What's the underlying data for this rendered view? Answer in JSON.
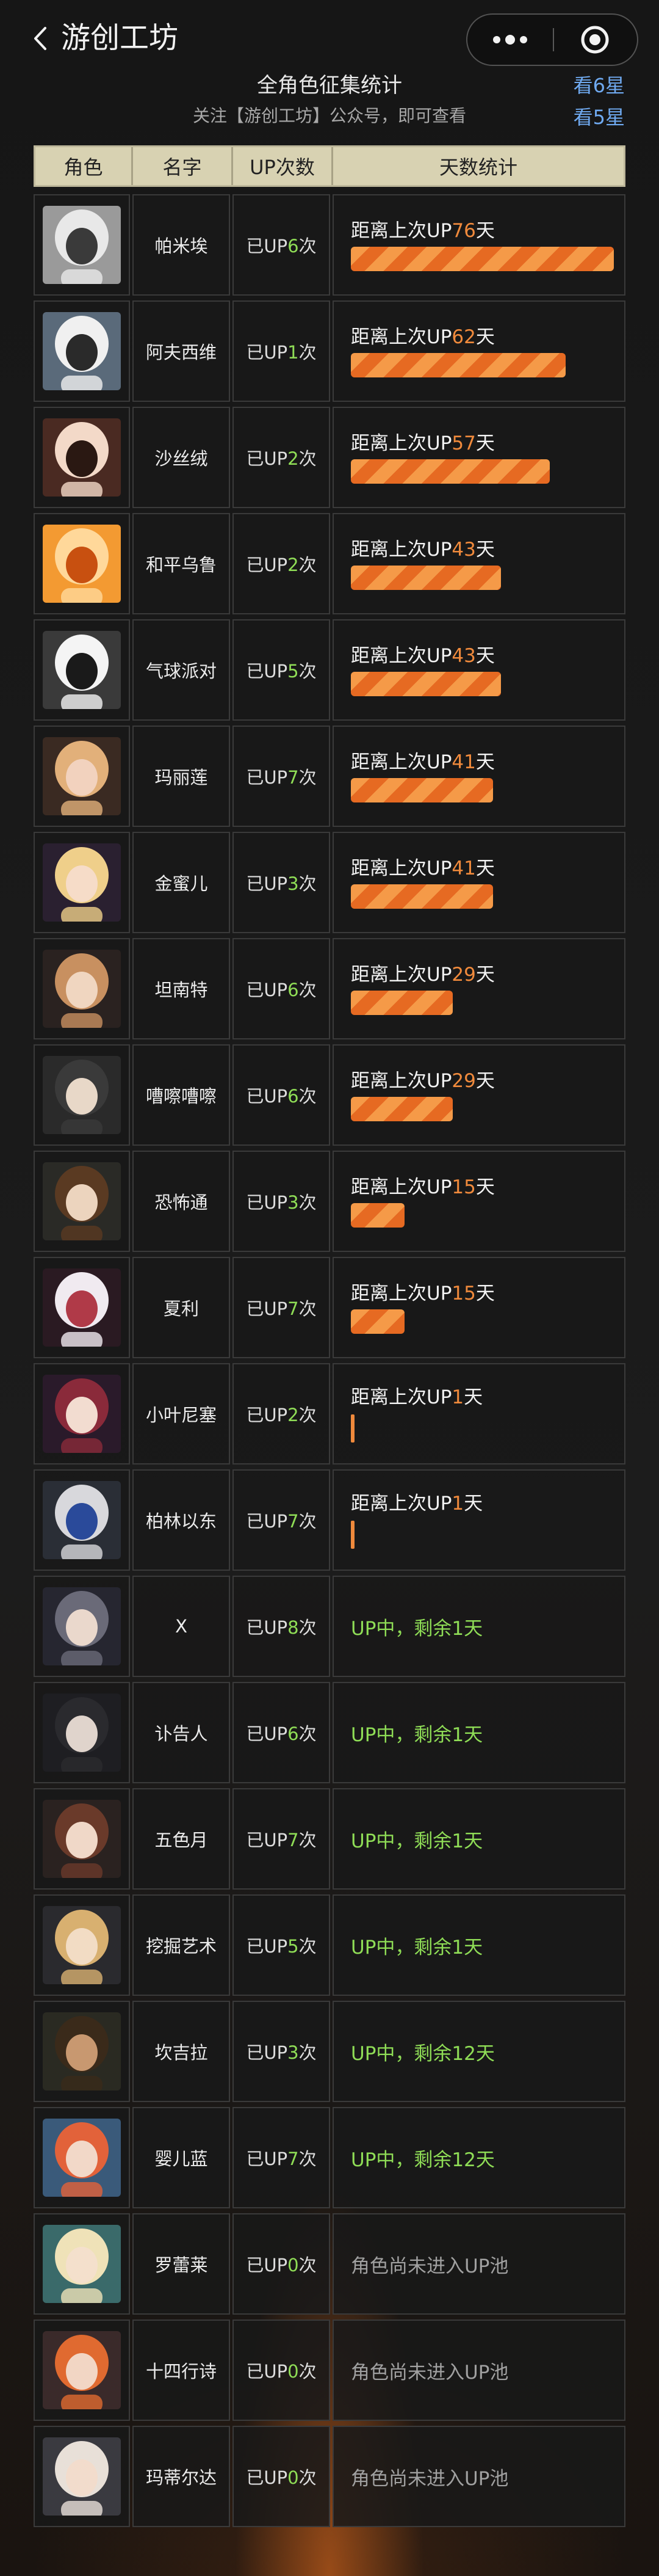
{
  "app": {
    "title": "游创工坊"
  },
  "header": {
    "title": "全角色征集统计",
    "subtitle": "关注【游创工坊】公众号，即可查看",
    "link_6star": "看6星",
    "link_5star": "看5星"
  },
  "table": {
    "columns": [
      "角色",
      "名字",
      "UP次数",
      "天数统计"
    ],
    "rows": [
      {
        "name": "帕米埃",
        "up_prefix": "已UP",
        "up_count": "6",
        "up_suffix": "次",
        "status": "distance",
        "dist_prefix": "距离上次UP",
        "days": "76",
        "dist_suffix": "天",
        "bar_fraction": 0.98,
        "palette": [
          "#9a9a9a",
          "#e8e8e8",
          "#3a3a3a"
        ]
      },
      {
        "name": "阿夫西维",
        "up_prefix": "已UP",
        "up_count": "1",
        "up_suffix": "次",
        "status": "distance",
        "dist_prefix": "距离上次UP",
        "days": "62",
        "dist_suffix": "天",
        "bar_fraction": 0.8,
        "palette": [
          "#5a6a7a",
          "#f0f0f0",
          "#2a2a2a"
        ]
      },
      {
        "name": "沙丝绒",
        "up_prefix": "已UP",
        "up_count": "2",
        "up_suffix": "次",
        "status": "distance",
        "dist_prefix": "距离上次UP",
        "days": "57",
        "dist_suffix": "天",
        "bar_fraction": 0.74,
        "palette": [
          "#4a2a22",
          "#f3d9c8",
          "#2a1812"
        ]
      },
      {
        "name": "和平乌鲁",
        "up_prefix": "已UP",
        "up_count": "2",
        "up_suffix": "次",
        "status": "distance",
        "dist_prefix": "距离上次UP",
        "days": "43",
        "dist_suffix": "天",
        "bar_fraction": 0.56,
        "palette": [
          "#f39a32",
          "#ffd89a",
          "#c85010"
        ]
      },
      {
        "name": "气球派对",
        "up_prefix": "已UP",
        "up_count": "5",
        "up_suffix": "次",
        "status": "distance",
        "dist_prefix": "距离上次UP",
        "days": "43",
        "dist_suffix": "天",
        "bar_fraction": 0.56,
        "palette": [
          "#3a3a3a",
          "#f4f4f4",
          "#1a1a1a"
        ]
      },
      {
        "name": "玛丽莲",
        "up_prefix": "已UP",
        "up_count": "7",
        "up_suffix": "次",
        "status": "distance",
        "dist_prefix": "距离上次UP",
        "days": "41",
        "dist_suffix": "天",
        "bar_fraction": 0.53,
        "palette": [
          "#3a2a22",
          "#e2b07a",
          "#f2d2be"
        ]
      },
      {
        "name": "金蜜儿",
        "up_prefix": "已UP",
        "up_count": "3",
        "up_suffix": "次",
        "status": "distance",
        "dist_prefix": "距离上次UP",
        "days": "41",
        "dist_suffix": "天",
        "bar_fraction": 0.53,
        "palette": [
          "#2a2030",
          "#efcf8a",
          "#f6dcc8"
        ]
      },
      {
        "name": "坦南特",
        "up_prefix": "已UP",
        "up_count": "6",
        "up_suffix": "次",
        "status": "distance",
        "dist_prefix": "距离上次UP",
        "days": "29",
        "dist_suffix": "天",
        "bar_fraction": 0.38,
        "palette": [
          "#2a2220",
          "#c89060",
          "#f0d6c0"
        ]
      },
      {
        "name": "嘈嚓嘈嚓",
        "up_prefix": "已UP",
        "up_count": "6",
        "up_suffix": "次",
        "status": "distance",
        "dist_prefix": "距离上次UP",
        "days": "29",
        "dist_suffix": "天",
        "bar_fraction": 0.38,
        "palette": [
          "#2a2a2a",
          "#3a3a3a",
          "#e8d8c8"
        ]
      },
      {
        "name": "恐怖通",
        "up_prefix": "已UP",
        "up_count": "3",
        "up_suffix": "次",
        "status": "distance",
        "dist_prefix": "距离上次UP",
        "days": "15",
        "dist_suffix": "天",
        "bar_fraction": 0.2,
        "palette": [
          "#2a2a26",
          "#5a3a22",
          "#ecd4be"
        ]
      },
      {
        "name": "夏利",
        "up_prefix": "已UP",
        "up_count": "7",
        "up_suffix": "次",
        "status": "distance",
        "dist_prefix": "距离上次UP",
        "days": "15",
        "dist_suffix": "天",
        "bar_fraction": 0.2,
        "palette": [
          "#2a1a22",
          "#f0eaf0",
          "#b03a48"
        ]
      },
      {
        "name": "小叶尼塞",
        "up_prefix": "已UP",
        "up_count": "2",
        "up_suffix": "次",
        "status": "distance",
        "dist_prefix": "距离上次UP",
        "days": "1",
        "dist_suffix": "天",
        "bar_fraction": 0.0,
        "palette": [
          "#2a1a2a",
          "#8a2a3a",
          "#f2dcd0"
        ]
      },
      {
        "name": "柏林以东",
        "up_prefix": "已UP",
        "up_count": "7",
        "up_suffix": "次",
        "status": "distance",
        "dist_prefix": "距离上次UP",
        "days": "1",
        "dist_suffix": "天",
        "bar_fraction": 0.0,
        "palette": [
          "#2a2e36",
          "#d8d8dc",
          "#2a4a9a"
        ]
      },
      {
        "name": "X",
        "up_prefix": "已UP",
        "up_count": "8",
        "up_suffix": "次",
        "status": "upnow",
        "upnow_text": "UP中，剩余1天",
        "palette": [
          "#262630",
          "#6a6a78",
          "#ead8cc"
        ]
      },
      {
        "name": "讣告人",
        "up_prefix": "已UP",
        "up_count": "6",
        "up_suffix": "次",
        "status": "upnow",
        "upnow_text": "UP中，剩余1天",
        "palette": [
          "#1e1e22",
          "#2a2a2e",
          "#e0d4cc"
        ]
      },
      {
        "name": "五色月",
        "up_prefix": "已UP",
        "up_count": "7",
        "up_suffix": "次",
        "status": "upnow",
        "upnow_text": "UP中，剩余1天",
        "palette": [
          "#2a2220",
          "#6a3a2a",
          "#f0d8c8"
        ]
      },
      {
        "name": "挖掘艺术",
        "up_prefix": "已UP",
        "up_count": "5",
        "up_suffix": "次",
        "status": "upnow",
        "upnow_text": "UP中，剩余1天",
        "palette": [
          "#2a2a2e",
          "#d8b070",
          "#f2dcc4"
        ]
      },
      {
        "name": "坎吉拉",
        "up_prefix": "已UP",
        "up_count": "3",
        "up_suffix": "次",
        "status": "upnow",
        "upnow_text": "UP中，剩余12天",
        "palette": [
          "#2a2a22",
          "#3a2a1a",
          "#c89870"
        ]
      },
      {
        "name": "婴儿蓝",
        "up_prefix": "已UP",
        "up_count": "7",
        "up_suffix": "次",
        "status": "upnow",
        "upnow_text": "UP中，剩余12天",
        "palette": [
          "#3a5a7a",
          "#e2623a",
          "#f2d8c8"
        ]
      },
      {
        "name": "罗蕾莱",
        "up_prefix": "已UP",
        "up_count": "0",
        "up_suffix": "次",
        "status": "notyet",
        "notyet_text": "角色尚未进入UP池",
        "palette": [
          "#3a6a6a",
          "#efe2b8",
          "#f4e0cc"
        ]
      },
      {
        "name": "十四行诗",
        "up_prefix": "已UP",
        "up_count": "0",
        "up_suffix": "次",
        "status": "notyet",
        "notyet_text": "角色尚未进入UP池",
        "palette": [
          "#3a2a2a",
          "#e06a30",
          "#f2d6c4"
        ]
      },
      {
        "name": "玛蒂尔达",
        "up_prefix": "已UP",
        "up_count": "0",
        "up_suffix": "次",
        "status": "notyet",
        "notyet_text": "角色尚未进入UP池",
        "palette": [
          "#3a3a40",
          "#e8e0d8",
          "#f2dccc"
        ]
      }
    ]
  },
  "colors": {
    "accent": "#f08a3c",
    "green": "#8fdd56",
    "link": "#6fa9ef",
    "header_bg": "#d8d2b2"
  }
}
